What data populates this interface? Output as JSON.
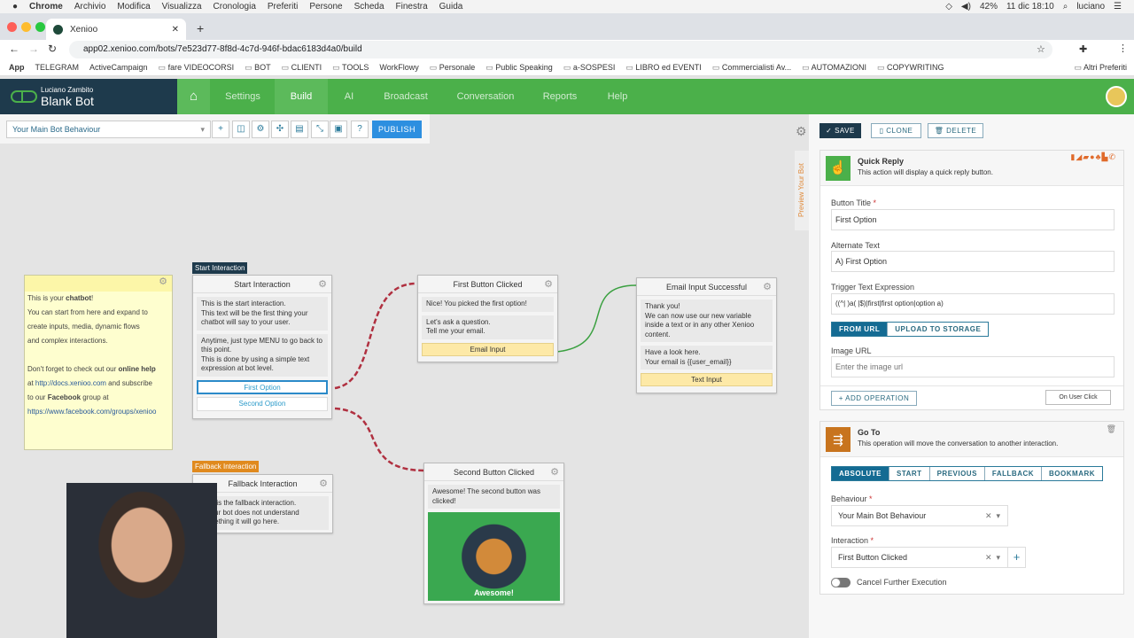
{
  "mac_menu": {
    "apple": "",
    "items": [
      "Chrome",
      "Archivio",
      "Modifica",
      "Visualizza",
      "Cronologia",
      "Preferiti",
      "Persone",
      "Scheda",
      "Finestra",
      "Guida"
    ],
    "battery": "42%",
    "datetime": "11 dic 18:10",
    "user": "luciano"
  },
  "browser": {
    "tab_title": "Xenioo",
    "url": "app02.xenioo.com/bots/7e523d77-8f8d-4c7d-946f-bdac6183d4a0/build",
    "bookmarks": [
      "App",
      "TELEGRAM",
      "ActiveCampaign",
      "fare VIDEOCORSI",
      "BOT",
      "CLIENTI",
      "TOOLS",
      "WorkFlowy",
      "Personale",
      "Public Speaking",
      "a-SOSPESI",
      "LIBRO ed EVENTI",
      "Commercialisti Av...",
      "AUTOMAZIONI",
      "COPYWRITING"
    ],
    "other_bookmarks": "Altri Preferiti"
  },
  "app": {
    "owner": "Luciano Zambito",
    "bot_name": "Blank Bot",
    "nav": [
      "Settings",
      "Build",
      "AI",
      "Broadcast",
      "Conversation",
      "Reports",
      "Help"
    ],
    "active_nav": "Build"
  },
  "toolbar": {
    "behaviour": "Your Main Bot Behaviour",
    "publish": "PUBLISH"
  },
  "note": {
    "l1a": "This is your ",
    "l1b": "chatbot",
    "l1c": "!",
    "l2": "You can start from here and expand to",
    "l3": "create inputs, media, dynamic flows",
    "l4": "and complex interactions.",
    "l5a": "Don't forget to check out our ",
    "l5b": "online help",
    "l6a": "at ",
    "l6b": "http://docs.xenioo.com",
    "l6c": " and subscribe",
    "l7a": "to our ",
    "l7b": "Facebook",
    "l7c": " group at",
    "l8": "https://www.facebook.com/groups/xenioo"
  },
  "nodes": {
    "start": {
      "tag": "Start Interaction",
      "title": "Start Interaction",
      "msg1": "This is the start interaction.\nThis text will be the first thing your chatbot will say to your user.",
      "msg2": "Anytime, just type MENU to go back to this point.\nThis is done by using a simple text expression at bot level.",
      "btn1": "First Option",
      "btn2": "Second Option"
    },
    "fallback": {
      "tag": "Fallback Interaction",
      "title": "Fallback Interaction",
      "msg1": "This is the fallback interaction.\nIf your bot does not understand something it will go here."
    },
    "first": {
      "title": "First Button Clicked",
      "msg1": "Nice! You picked the first option!",
      "msg2": "Let's ask a question.\nTell me your email.",
      "input": "Email Input"
    },
    "email": {
      "title": "Email Input Successful",
      "msg1": "Thank you!\nWe can now use our new variable inside a text or in any other Xenioo content.",
      "msg2": "Have a look here.\nYour email is {{user_email}}",
      "input": "Text Input"
    },
    "second": {
      "title": "Second Button Clicked",
      "msg1": "Awesome! The second button was clicked!",
      "gif_caption": "Awesome!"
    }
  },
  "panel": {
    "preview": "Preview Your Bot",
    "save": "✓ SAVE",
    "clone": "CLONE",
    "delete": "DELETE",
    "quick_reply": {
      "title": "Quick Reply",
      "desc": "This action will display a quick reply button.",
      "button_title_label": "Button Title",
      "button_title": "First Option",
      "alt_label": "Alternate Text",
      "alt": "A) First Option",
      "trigger_label": "Trigger Text Expression",
      "trigger": "((^| )a( |$)|first|first option|option a)",
      "from_url": "FROM URL",
      "upload": "UPLOAD TO STORAGE",
      "image_label": "Image URL",
      "image_placeholder": "Enter the image url",
      "add_op": "+ ADD OPERATION",
      "on_click": "On User Click"
    },
    "goto": {
      "title": "Go To",
      "desc": "This operation will move the conversation to another interaction.",
      "modes": [
        "ABSOLUTE",
        "START",
        "PREVIOUS",
        "FALLBACK",
        "BOOKMARK"
      ],
      "active_mode": "ABSOLUTE",
      "behaviour_label": "Behaviour",
      "behaviour": "Your Main Bot Behaviour",
      "interaction_label": "Interaction",
      "interaction": "First Button Clicked",
      "cancel_label": "Cancel Further Execution",
      "cancel_on": false
    }
  },
  "colors": {
    "nav_green": "#4bb04a",
    "brand_dark": "#1e3a4c",
    "accent_blue": "#146b93",
    "publish": "#2d8fe0",
    "red_connector": "#b03040",
    "green_connector": "#3aa040"
  }
}
